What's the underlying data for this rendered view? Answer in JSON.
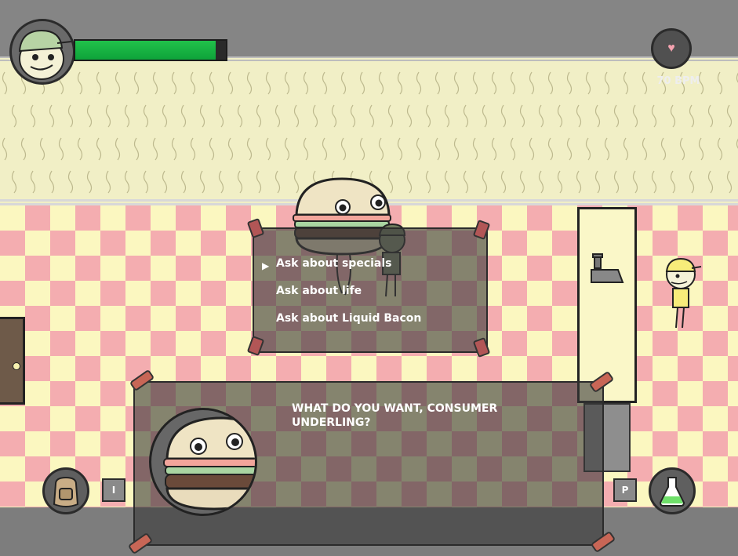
{
  "hud": {
    "health_fraction": 0.93,
    "bpm_text": "70 BPM"
  },
  "dialog_menu": {
    "options": [
      "Ask about specials",
      "Ask about life",
      "Ask about Liquid Bacon"
    ],
    "selected_index": 0
  },
  "dialog": {
    "text": "WHAT DO YOU WANT, CONSUMER UNDERLING?"
  },
  "hotkeys": {
    "inventory_key": "I",
    "potion_key": "P"
  },
  "icons": [
    "heart-icon",
    "backpack-icon",
    "potion-flask-icon",
    "cursor-arrow-icon",
    "cash-register-icon"
  ]
}
